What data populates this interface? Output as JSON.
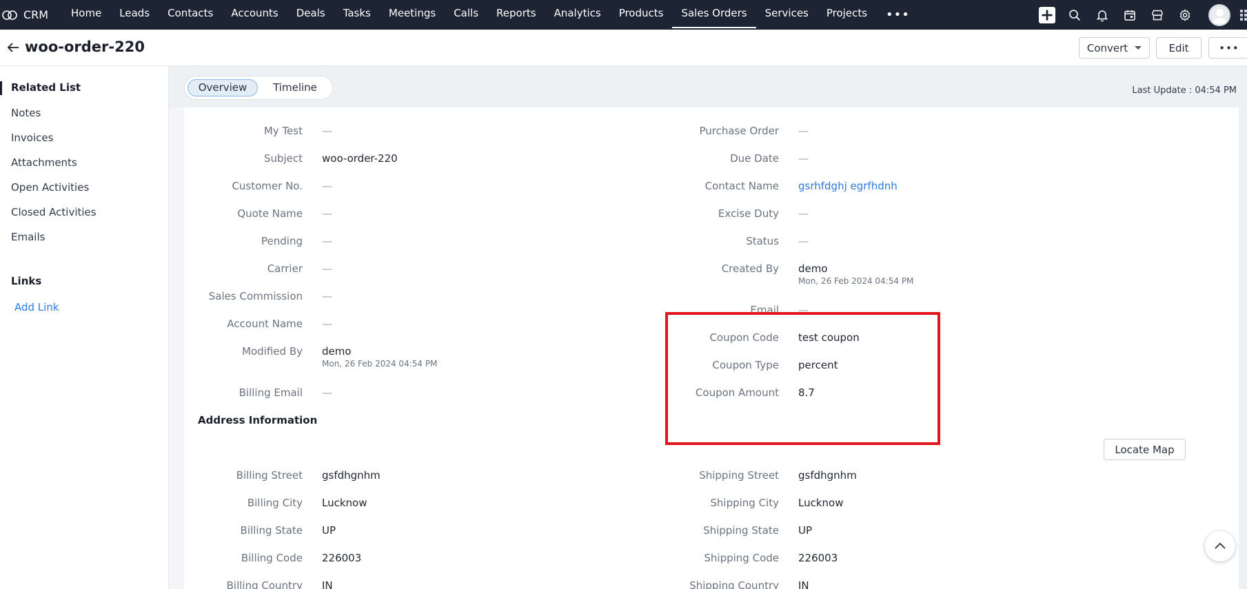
{
  "nav": {
    "brand": "CRM",
    "tabs": [
      "Home",
      "Leads",
      "Contacts",
      "Accounts",
      "Deals",
      "Tasks",
      "Meetings",
      "Calls",
      "Reports",
      "Analytics",
      "Products",
      "Sales Orders",
      "Services",
      "Projects"
    ],
    "active_tab": "Sales Orders",
    "more": "•••",
    "icons": [
      "plus-icon",
      "search-icon",
      "bell-icon",
      "calendar-icon",
      "store-icon",
      "gear-icon",
      "avatar",
      "apps-grid-icon"
    ]
  },
  "record": {
    "title": "woo-order-220",
    "convert_label": "Convert",
    "edit_label": "Edit",
    "more_label": "•••"
  },
  "sidebar": {
    "related_heading": "Related List",
    "items": [
      "Notes",
      "Invoices",
      "Attachments",
      "Open Activities",
      "Closed Activities",
      "Emails"
    ],
    "links_heading": "Links",
    "add_link": "Add Link"
  },
  "tabs": {
    "overview": "Overview",
    "timeline": "Timeline",
    "last_update": "Last Update : 04:54 PM"
  },
  "fields": {
    "left": [
      {
        "label": "My Test",
        "value": "—"
      },
      {
        "label": "Subject",
        "value": "woo-order-220"
      },
      {
        "label": "Customer No.",
        "value": "—"
      },
      {
        "label": "Quote Name",
        "value": "—"
      },
      {
        "label": "Pending",
        "value": "—"
      },
      {
        "label": "Carrier",
        "value": "—"
      },
      {
        "label": "Sales Commission",
        "value": "—"
      },
      {
        "label": "Account Name",
        "value": "—"
      },
      {
        "label": "Modified By",
        "value": "demo",
        "sub": "Mon, 26 Feb 2024 04:54 PM"
      },
      {
        "label": "Billing Email",
        "value": "—"
      }
    ],
    "right": [
      {
        "label": "Purchase Order",
        "value": "—"
      },
      {
        "label": "Due Date",
        "value": "—"
      },
      {
        "label": "Contact Name",
        "value": "gsrhfdghj egrfhdnh"
      },
      {
        "label": "Excise Duty",
        "value": "—"
      },
      {
        "label": "Status",
        "value": "—"
      },
      {
        "label": "Created By",
        "value": "demo",
        "sub": "Mon, 26 Feb 2024 04:54 PM"
      },
      {
        "label": "Email",
        "value": "—"
      },
      {
        "label": "Coupon Code",
        "value": "test coupon"
      },
      {
        "label": "Coupon Type",
        "value": "percent"
      },
      {
        "label": "Coupon Amount",
        "value": "8.7"
      }
    ]
  },
  "address": {
    "heading": "Address Information",
    "locate_map": "Locate Map",
    "left": [
      {
        "label": "Billing Street",
        "value": "gsfdhgnhm"
      },
      {
        "label": "Billing City",
        "value": "Lucknow"
      },
      {
        "label": "Billing State",
        "value": "UP"
      },
      {
        "label": "Billing Code",
        "value": "226003"
      },
      {
        "label": "Billing Country",
        "value": "IN"
      }
    ],
    "right": [
      {
        "label": "Shipping Street",
        "value": "gsfdhgnhm"
      },
      {
        "label": "Shipping City",
        "value": "Lucknow"
      },
      {
        "label": "Shipping State",
        "value": "UP"
      },
      {
        "label": "Shipping Code",
        "value": "226003"
      },
      {
        "label": "Shipping Country",
        "value": "IN"
      }
    ]
  },
  "colors": {
    "nav_bg": "#1d2534",
    "link": "#2d7be0",
    "highlight": "#e3141c"
  }
}
